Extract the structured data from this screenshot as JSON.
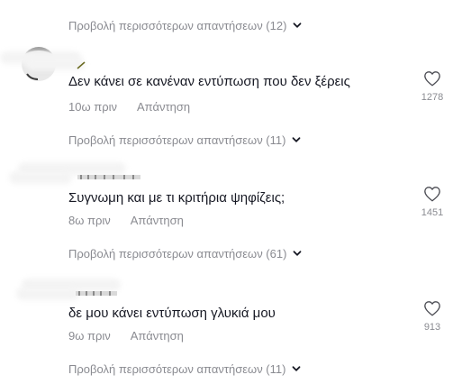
{
  "replies_toggle_top": {
    "label": "Προβολή περισσότερων απαντήσεων (12)"
  },
  "comments": [
    {
      "text": "Δεν κάνει σε κανέναν εντύπωση που δεν ξέρεις",
      "time": "10ω πριν",
      "reply_label": "Απάντηση",
      "likes": "1278",
      "replies_toggle": "Προβολή περισσότερων απαντήσεων (11)"
    },
    {
      "text": "Συγνωμη και με τι κριτήρια ψηφίζεις;",
      "time": "8ω πριν",
      "reply_label": "Απάντηση",
      "likes": "1451",
      "replies_toggle": "Προβολή περισσότερων απαντήσεων (61)"
    },
    {
      "text": "δε μου κάνει εντύπωση γλυκιά μου",
      "time": "9ω πριν",
      "reply_label": "Απάντηση",
      "likes": "913",
      "replies_toggle": "Προβολή περισσότερων απαντήσεων (11)"
    }
  ],
  "icons": {
    "like": "heart-outline-icon",
    "expand": "chevron-down-icon"
  },
  "colors": {
    "text": "#161823",
    "muted": "#8a8b91",
    "background": "#ffffff"
  }
}
